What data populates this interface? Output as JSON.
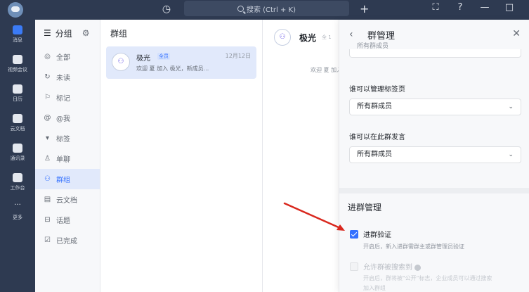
{
  "topbar": {
    "search_text": "搜索 (Ctrl + K)"
  },
  "nav": [
    {
      "label": "消息",
      "active": true
    },
    {
      "label": "视频会议"
    },
    {
      "label": "日历"
    },
    {
      "label": "云文档"
    },
    {
      "label": "通讯录"
    },
    {
      "label": "工作台"
    },
    {
      "label": "更多"
    }
  ],
  "filters": {
    "title": "分组",
    "items": [
      {
        "icon": "◎",
        "label": "全部"
      },
      {
        "icon": "↻",
        "label": "未读"
      },
      {
        "icon": "⚐",
        "label": "标记"
      },
      {
        "icon": "@",
        "label": "@我"
      },
      {
        "icon": "▾",
        "label": "标签"
      },
      {
        "icon": "♙",
        "label": "单聊"
      },
      {
        "icon": "⚇",
        "label": "群组",
        "active": true
      },
      {
        "icon": "▤",
        "label": "云文档"
      },
      {
        "icon": "⊟",
        "label": "话题"
      },
      {
        "icon": "☑",
        "label": "已完成"
      }
    ]
  },
  "list": {
    "title": "群组",
    "chat": {
      "name": "极光",
      "tag": "全员",
      "time": "12月12日",
      "preview": "欢迎 夏 加入 极光，新成员..."
    }
  },
  "chat": {
    "title": "极光",
    "subtitle": "全 1",
    "hint": "欢迎 夏 加入 极"
  },
  "panel": {
    "title": "群管理",
    "top_select_value": "所有群成员",
    "tag_manage_label": "谁可以管理标签页",
    "tag_manage_value": "所有群成员",
    "speak_label": "谁可以在此群发言",
    "speak_value": "所有群成员",
    "mgmt_title": "进群管理",
    "verify_label": "进群验证",
    "verify_desc": "开启后，新入进群需群主或群管理员验证",
    "verify_checked": true,
    "public_label": "允许群被搜索到",
    "public_desc": "开启后，群将被\"公开\"标志，企业成员可以通过搜索",
    "public_desc2": "加入群组",
    "public_checked": false
  },
  "colors": {
    "sidebar": "#2e3a51",
    "accent": "#3370ff",
    "arrow": "#d9281e"
  }
}
